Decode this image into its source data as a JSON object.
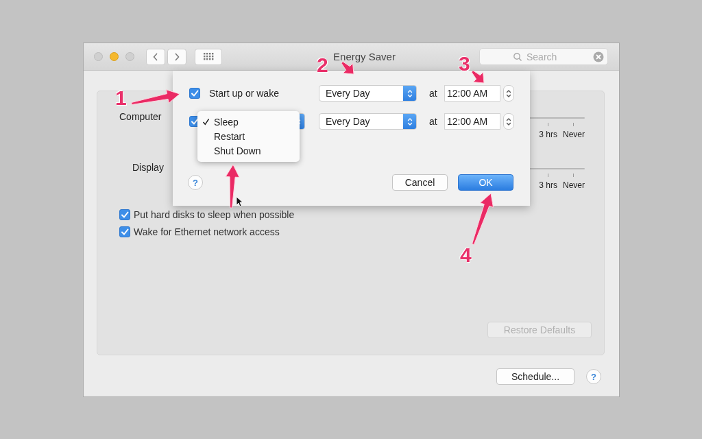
{
  "window": {
    "title": "Energy Saver",
    "search": {
      "placeholder": "Search"
    }
  },
  "settings": {
    "sliders": [
      {
        "label": "Computer",
        "ticks": [
          "3 hrs",
          "Never"
        ]
      },
      {
        "label": "Display",
        "ticks": [
          "3 hrs",
          "Never"
        ]
      }
    ],
    "options": [
      {
        "label": "Put hard disks to sleep when possible",
        "checked": true
      },
      {
        "label": "Wake for Ethernet network access",
        "checked": true
      }
    ],
    "restore_button": {
      "label": "Restore Defaults",
      "disabled": true
    }
  },
  "schedule_button": "Schedule...",
  "help": "?",
  "sheet": {
    "rows": [
      {
        "checked": true,
        "label": "Start up or wake",
        "repeat": "Every Day",
        "at": "at",
        "time": "12:00 AM"
      },
      {
        "checked": true,
        "repeat": "Every Day",
        "at": "at",
        "time": "12:00 AM"
      }
    ],
    "menu": [
      {
        "label": "Sleep",
        "selected": true
      },
      {
        "label": "Restart",
        "selected": false
      },
      {
        "label": "Shut Down",
        "selected": false
      }
    ],
    "help": "?",
    "buttons": [
      {
        "label": "Cancel",
        "default": false
      },
      {
        "label": "OK",
        "default": true
      }
    ]
  },
  "annotations": [
    {
      "kind": "numbered",
      "label": "1"
    },
    {
      "kind": "numbered",
      "label": "2"
    },
    {
      "kind": "numbered",
      "label": "3"
    },
    {
      "kind": "numbered",
      "label": "4"
    },
    {
      "kind": "arrow"
    }
  ]
}
